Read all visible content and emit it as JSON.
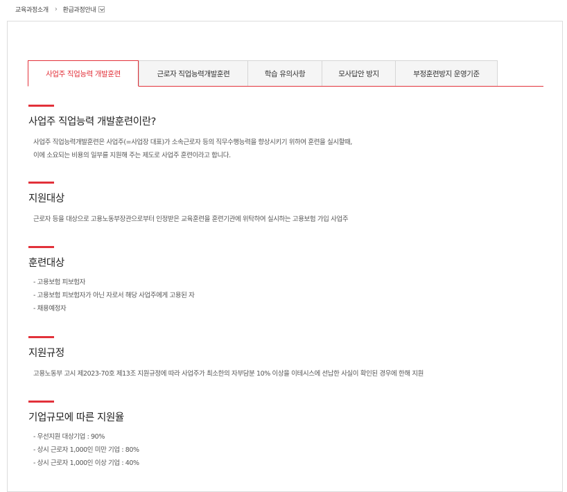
{
  "breadcrumb": {
    "home": "교육과정소개",
    "separator": "›",
    "current": "환급과정안내"
  },
  "tabs": [
    {
      "label": "사업주 직업능력 개발훈련",
      "active": true
    },
    {
      "label": "근로자 직업능력개발훈련",
      "active": false
    },
    {
      "label": "학습 유의사항",
      "active": false
    },
    {
      "label": "모사답안 방지",
      "active": false
    },
    {
      "label": "부정훈련방지 운영기준",
      "active": false
    }
  ],
  "sections": {
    "intro": {
      "title": "사업주 직업능력 개발훈련이란?",
      "lines": [
        "사업주 직업능력개발훈련은 사업주(=사업장 대표)가 소속근로자 등의 직무수행능력을 향상시키기 위하여 훈련을 실시할때,",
        "이에 소요되는 비용의 일부를 지원해 주는 제도로 사업주 훈련이라고 합니다."
      ]
    },
    "support_target": {
      "title": "지원대상",
      "lines": [
        "근로자 등을 대상으로 고용노동부장관으로부터 인정받은 교육훈련을 훈련기관에 위탁하여 실시하는 고용보험 가입 사업주"
      ]
    },
    "trainee": {
      "title": "훈련대상",
      "lines": [
        "- 고용보험 피보험자",
        "- 고용보험 피보험자가 아닌 자로서 해당 사업주에게 고용된 자",
        "- 채용예정자"
      ]
    },
    "regulation": {
      "title": "지원규정",
      "lines": [
        "고용노동부 고시 제2023-70호 제13조 지원규정에 따라 사업주가 최소한의 자부담분 10% 이상을 이테시스에 선납한 사실이 확인된 경우에 한해 지원"
      ]
    },
    "rate": {
      "title": "기업규모에 따른 지원율",
      "lines": [
        "- 우선지원 대상기업 : 90%",
        "- 상시 근로자 1,000인 미만 기업 : 80%",
        "- 상시 근로자 1,000인 이상 기업 : 40%"
      ]
    }
  },
  "colors": {
    "accent": "#e2313a",
    "tab_bg": "#f5f5f5",
    "border": "#dcdcdc"
  }
}
